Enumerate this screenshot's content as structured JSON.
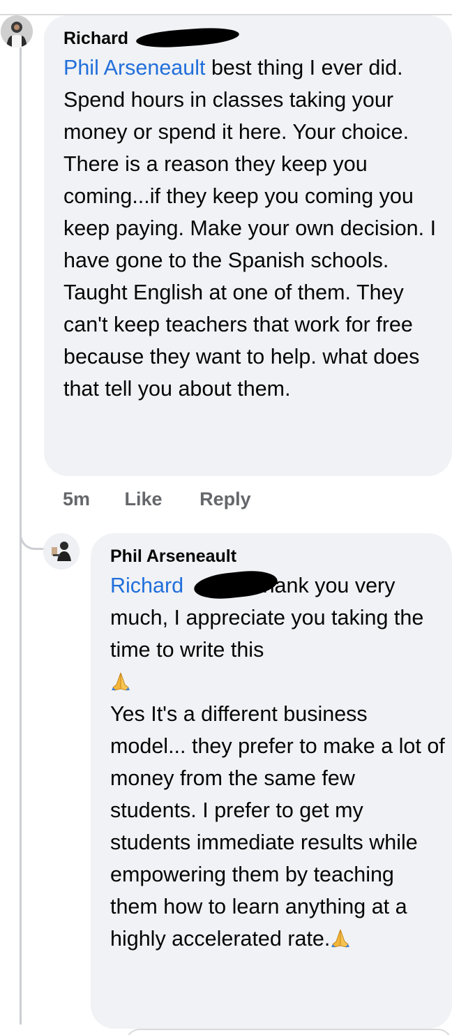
{
  "comment": {
    "author": "Richard",
    "mention": "Phil Arseneault",
    "text": " best thing I ever did. Spend hours in classes taking your money or spend it here. Your choice. There is a reason they keep you coming...if they keep you coming you keep paying. Make your own decision. I have gone to the Spanish schools. Taught English at one of them. They can't keep teachers that work for free because they want to help. what does that tell you about them.",
    "time": "5m",
    "like_label": "Like",
    "reply_label": "Reply"
  },
  "reply": {
    "author": "Phil Arseneault",
    "mention": "Richard",
    "text_1": "thank you very much, I appreciate you taking the time to write this",
    "text_2": "Yes It's a different business model... they prefer to make a lot of money from the same few students. I prefer to get my students immediate results while empowering them by teaching them how to learn anything at a highly accelerated rate.",
    "emoji": "folded-hands-icon"
  },
  "colors": {
    "mention": "#216fdb",
    "bubble": "#f0f2f5",
    "meta": "#65676b",
    "thread_line": "#ccced2"
  }
}
